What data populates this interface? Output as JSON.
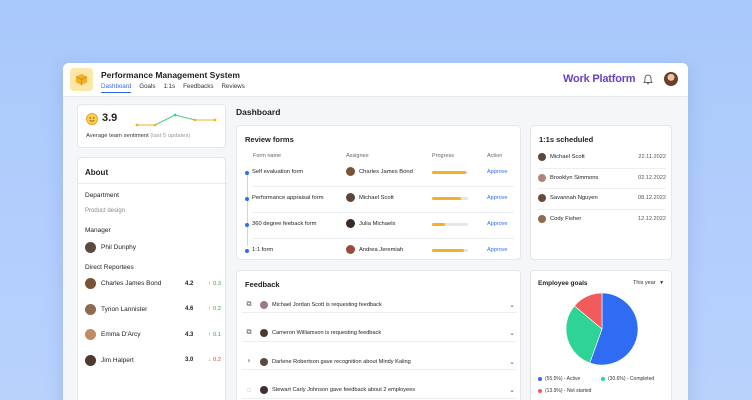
{
  "header": {
    "title": "Performance Management System",
    "nav": [
      "Dashboard",
      "Goals",
      "1:1s",
      "Feedbacks",
      "Reviews"
    ],
    "brand": "Work Platform"
  },
  "sentiment": {
    "value": "3.9",
    "label": "Average team sentiment",
    "sublabel": "(last 5 updates)"
  },
  "about": {
    "title": "About",
    "department_label": "Department",
    "department_value": "Product design",
    "manager_label": "Manager",
    "manager_name": "Phil Dunphy",
    "reportees_label": "Direct Reportees",
    "reportees": [
      {
        "name": "Charles James Bond",
        "score": "4.2",
        "delta": "0.3",
        "dir": "up",
        "color": "#7a5236"
      },
      {
        "name": "Tyrion Lannister",
        "score": "4.6",
        "delta": "0.2",
        "dir": "up",
        "color": "#8c6b4f"
      },
      {
        "name": "Emma D'Arcy",
        "score": "4.3",
        "delta": "0.1",
        "dir": "up",
        "color": "#c28a63"
      },
      {
        "name": "Jim Halpert",
        "score": "3.0",
        "delta": "0.2",
        "dir": "down",
        "color": "#4e3a2f"
      }
    ]
  },
  "dashboard": {
    "title": "Dashboard"
  },
  "review_forms": {
    "title": "Review forms",
    "columns": [
      "Form name",
      "Assignee",
      "Progress",
      "Action"
    ],
    "rows": [
      {
        "form": "Self evaluation form",
        "assignee": "Charles James Bond",
        "progress": 0.95,
        "action": "Approve",
        "color": "#7a5236"
      },
      {
        "form": "Performance appraisal form",
        "assignee": "Michael Scott",
        "progress": 0.8,
        "action": "Approve",
        "color": "#5c4638"
      },
      {
        "form": "360 degree feeback form",
        "assignee": "Julia Michaels",
        "progress": 0.35,
        "action": "Approve",
        "color": "#3a2a24"
      },
      {
        "form": "1:1 form",
        "assignee": "Andrea Jeremiah",
        "progress": 0.9,
        "action": "Approve",
        "color": "#9a4b3c"
      }
    ]
  },
  "one_on_ones": {
    "title": "1:1s scheduled",
    "rows": [
      {
        "name": "Michael Scott",
        "date": "22.11.2022",
        "color": "#5c4638"
      },
      {
        "name": "Brooklyn Simmons",
        "date": "02.12.2022",
        "color": "#b2837a"
      },
      {
        "name": "Savannah Nguyen",
        "date": "08.12.2022",
        "color": "#6a4a3c"
      },
      {
        "name": "Cody Fisher",
        "date": "12.12.2022",
        "color": "#8f6a52"
      }
    ]
  },
  "feedback": {
    "title": "Feedback",
    "rows": [
      {
        "icon": "feedback-request-icon",
        "glyph": "⧉",
        "text": "Michael Jordan Scott is requesting feedback",
        "color": "#9a7a8a"
      },
      {
        "icon": "feedback-request-icon",
        "glyph": "⧉",
        "text": "Cameron Williamson is requesting feedback",
        "color": "#4a3a32"
      },
      {
        "icon": "recognition-icon",
        "glyph": "♀",
        "text": "Darlene Robertson gave recognition about Mindy Kaling",
        "color": "#5a4a40"
      },
      {
        "icon": "comment-icon",
        "glyph": "◌",
        "text": "Stewart Carly Johnson gave feedback about 2 employees",
        "color": "#3e3030"
      }
    ]
  },
  "goals": {
    "title": "Employee goals",
    "period": "This year",
    "legend": [
      {
        "label": "(55.5%) - Active",
        "value": 55.5,
        "color": "#2f6bf3"
      },
      {
        "label": "(30.6%) - Completed",
        "value": 30.6,
        "color": "#2ed496"
      },
      {
        "label": "(13.9%) - Not started",
        "value": 13.9,
        "color": "#f25b5b"
      }
    ]
  },
  "colors": {
    "accent": "#2f6bf3",
    "progress": "#f2b227",
    "brand": "#6a3fc9"
  }
}
